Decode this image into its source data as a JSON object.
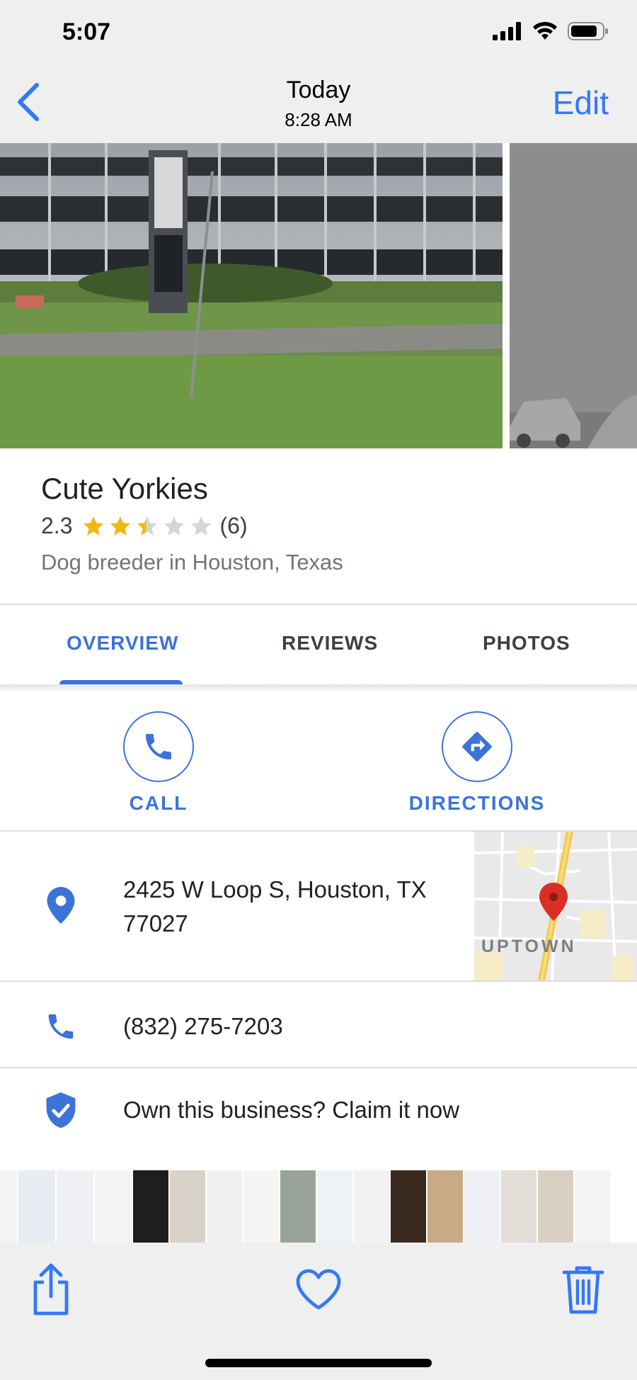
{
  "status_bar": {
    "time": "5:07"
  },
  "nav": {
    "title": "Today",
    "subtitle": "8:28 AM",
    "edit_label": "Edit",
    "back_icon": "chevron-left-icon"
  },
  "place": {
    "name": "Cute Yorkies",
    "rating": "2.3",
    "rating_value": 2.3,
    "review_count": "(6)",
    "category": "Dog breeder in Houston, Texas"
  },
  "tabs": [
    {
      "label": "OVERVIEW",
      "active": true
    },
    {
      "label": "REVIEWS",
      "active": false
    },
    {
      "label": "PHOTOS",
      "active": false
    }
  ],
  "actions": {
    "call_label": "CALL",
    "directions_label": "DIRECTIONS"
  },
  "info": {
    "address_line1": "2425 W Loop S, Houston, TX",
    "address_line2": "77027",
    "phone": "(832) 275-7203",
    "claim": "Own this business? Claim it now",
    "map_label": "UPTOWN"
  },
  "colors": {
    "accent": "#3b73d8",
    "ios_blue": "#3478f6",
    "star": "#f2b713",
    "map_pin": "#d93025"
  },
  "toolbar": {
    "share_icon": "share-icon",
    "favorite_icon": "heart-icon",
    "delete_icon": "trash-icon"
  }
}
